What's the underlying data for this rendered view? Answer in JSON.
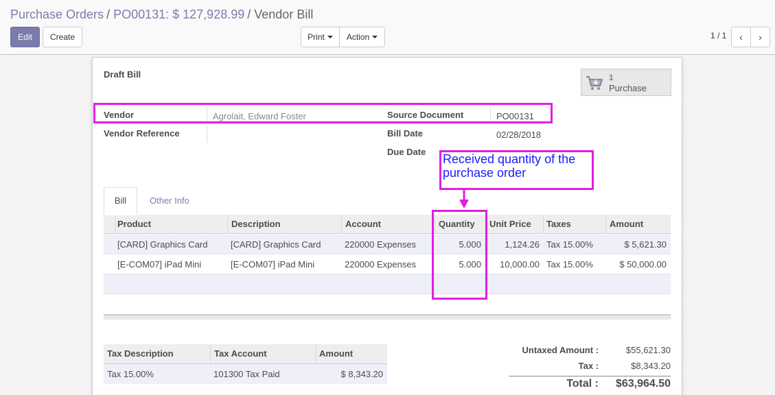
{
  "breadcrumb": {
    "items": [
      "Purchase Orders",
      "PO00131: $ 127,928.99"
    ],
    "current": "Vendor Bill",
    "separator": "/"
  },
  "toolbar": {
    "edit_label": "Edit",
    "create_label": "Create",
    "print_label": "Print",
    "action_label": "Action"
  },
  "pager": {
    "value": "1 / 1"
  },
  "sheet": {
    "status": "Draft Bill",
    "smart_button": {
      "count": "1",
      "label": "Purchase",
      "icon": "cart-icon"
    },
    "fields": {
      "vendor_label": "Vendor",
      "vendor_value": "Agrolait, Edward Foster",
      "vendor_ref_label": "Vendor Reference",
      "source_doc_label": "Source Document",
      "source_doc_value": "PO00131",
      "bill_date_label": "Bill Date",
      "bill_date_value": "02/28/2018",
      "due_date_label": "Due Date"
    }
  },
  "annotation": {
    "text": "Received quantity of the purchase order",
    "color": "#e01ee0"
  },
  "tabs": [
    "Bill",
    "Other Info"
  ],
  "lines": {
    "columns": [
      "Product",
      "Description",
      "Account",
      "Quantity",
      "Unit Price",
      "Taxes",
      "Amount"
    ],
    "rows": [
      [
        "[CARD] Graphics Card",
        "[CARD] Graphics Card",
        "220000 Expenses",
        "5.000",
        "1,124.26",
        "Tax 15.00%",
        "$ 5,621.30"
      ],
      [
        "[E-COM07] iPad Mini",
        "[E-COM07] iPad Mini",
        "220000 Expenses",
        "5.000",
        "10,000.00",
        "Tax 15.00%",
        "$ 50,000.00"
      ]
    ]
  },
  "tax_table": {
    "columns": [
      "Tax Description",
      "Tax Account",
      "Amount"
    ],
    "rows": [
      [
        "Tax 15.00%",
        "101300 Tax Paid",
        "$ 8,343.20"
      ]
    ]
  },
  "totals": {
    "untaxed_label": "Untaxed Amount :",
    "untaxed_value": "$55,621.30",
    "tax_label": "Tax :",
    "tax_value": "$8,343.20",
    "total_label": "Total :",
    "total_value": "$63,964.50"
  },
  "colors": {
    "brand": "#7c7bad",
    "highlight": "#e01ee0",
    "annotation_text": "#1a1aff"
  }
}
